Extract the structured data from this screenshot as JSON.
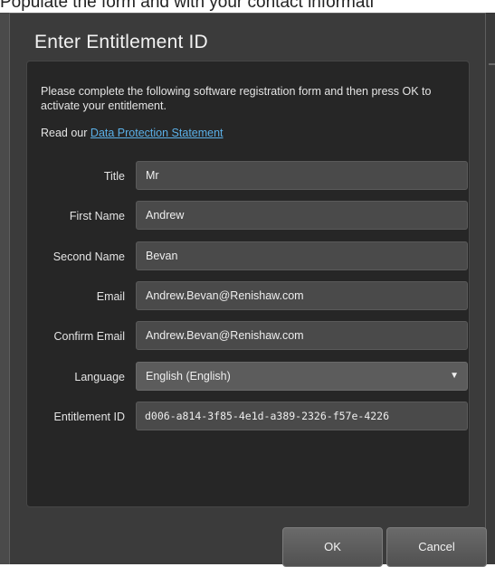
{
  "background": {
    "caption": "Populate the form and with your contact informati"
  },
  "dialog": {
    "title": "Enter Entitlement ID",
    "intro": "Please complete the following software registration form and then press OK to activate your entitlement.",
    "data_protection_prefix": "Read our",
    "data_protection_link": "Data Protection Statement"
  },
  "form": {
    "fields": [
      {
        "label": "Title",
        "value": "Mr"
      },
      {
        "label": "First Name",
        "value": "Andrew"
      },
      {
        "label": "Second Name",
        "value": "Bevan"
      },
      {
        "label": "Email",
        "value": "Andrew.Bevan@Renishaw.com"
      },
      {
        "label": "Confirm Email",
        "value": "Andrew.Bevan@Renishaw.com"
      },
      {
        "label": "Language",
        "value": "English (English)",
        "icon": "chevron-down-icon"
      },
      {
        "label": "Entitlement ID",
        "value": "d006-a814-3f85-4e1d-a389-2326-f57e-4226"
      }
    ]
  },
  "buttons": {
    "ok": "OK",
    "cancel": "Cancel"
  },
  "colors": {
    "dialog_bg": "#3b3b3b",
    "panel_bg": "#262626",
    "field_bg": "#4a4a4a",
    "link": "#5bb0e8"
  }
}
